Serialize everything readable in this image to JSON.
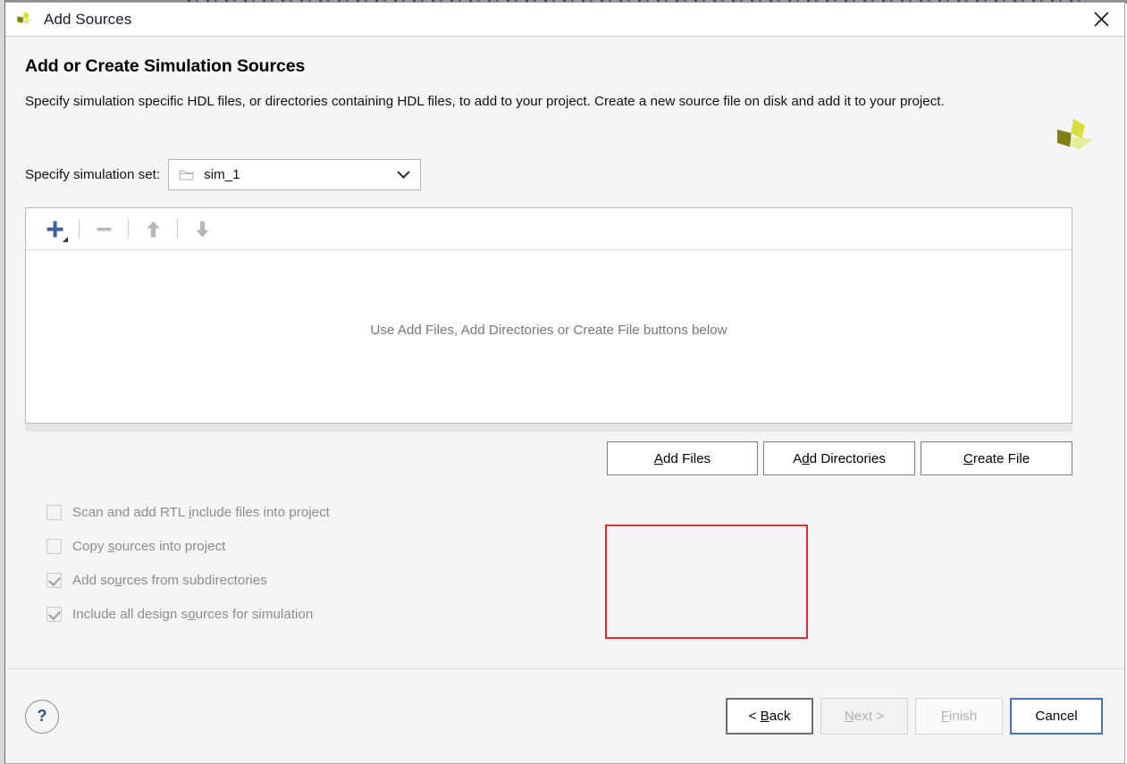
{
  "window": {
    "title": "Add Sources",
    "logo_icon": "xilinx-logo-icon",
    "close_icon": "close-icon"
  },
  "header": {
    "heading": "Add or Create Simulation Sources",
    "description": "Specify simulation specific HDL files, or directories containing HDL files, to add to your project. Create a new source file on disk and add it to your project.",
    "logo_icon": "xilinx-logo-icon"
  },
  "simulation_set": {
    "label": "Specify simulation set:",
    "value": "sim_1",
    "folder_icon": "folder-icon",
    "chevron_icon": "chevron-down-icon"
  },
  "file_panel": {
    "toolbar": {
      "add_icon": "plus-icon",
      "add_dropdown_icon": "dropdown-caret-icon",
      "remove_icon": "minus-icon",
      "move_up_icon": "arrow-up-icon",
      "move_down_icon": "arrow-down-icon"
    },
    "empty_message": "Use Add Files, Add Directories or Create File buttons below"
  },
  "action_buttons": [
    {
      "name": "add-files-button",
      "pre": "A",
      "mnemonic": "",
      "label_before": "A",
      "label_mnemonic": "A",
      "label_rest": "dd Files",
      "text": "Add Files"
    },
    {
      "name": "add-directories-button",
      "pre": "Ad",
      "mnemonic": "d",
      "label_rest": "d Directories",
      "text": "Add Directories"
    },
    {
      "name": "create-file-button",
      "pre": "",
      "mnemonic": "C",
      "label_rest": "reate File",
      "text": "Create File"
    }
  ],
  "action_labels": {
    "add_files_head": "",
    "add_files_mnemonic": "A",
    "add_files_tail": "dd Files",
    "add_dirs_head": "A",
    "add_dirs_mnemonic": "d",
    "add_dirs_tail": "d Directories",
    "create_file_head": "",
    "create_file_mnemonic": "C",
    "create_file_tail": "reate File"
  },
  "annotation": {
    "shape": "rectangle",
    "color": "#e8262d",
    "highlights": "create-file-button"
  },
  "checkboxes": [
    {
      "name": "scan-rtl-include-checkbox",
      "checked": false,
      "enabled": false,
      "head": "Scan and add RTL ",
      "mnemonic": "i",
      "tail": "nclude files into project",
      "text": "Scan and add RTL include files into project"
    },
    {
      "name": "copy-sources-checkbox",
      "checked": false,
      "enabled": false,
      "head": "Copy ",
      "mnemonic": "s",
      "tail": "ources into project",
      "text": "Copy sources into project"
    },
    {
      "name": "add-subdirectories-checkbox",
      "checked": true,
      "enabled": false,
      "head": "Add so",
      "mnemonic": "u",
      "tail": "rces from subdirectories",
      "text": "Add sources from subdirectories"
    },
    {
      "name": "include-design-sources-checkbox",
      "checked": true,
      "enabled": false,
      "head": "Include all design s",
      "mnemonic": "o",
      "tail": "urces for simulation",
      "text": "Include all design sources for simulation"
    }
  ],
  "footer": {
    "help_label": "?",
    "back": {
      "head": "< ",
      "mnemonic": "B",
      "tail": "ack",
      "text": "< Back",
      "enabled": true
    },
    "next": {
      "head": "",
      "mnemonic": "N",
      "tail": "ext >",
      "text": "Next >",
      "enabled": false
    },
    "finish": {
      "head": "",
      "mnemonic": "F",
      "tail": "inish",
      "text": "Finish",
      "enabled": false
    },
    "cancel": {
      "text": "Cancel",
      "enabled": true,
      "focused": true
    }
  },
  "colors": {
    "accent_blue": "#3f74c0",
    "annotation_red": "#e8262d",
    "plus_blue": "#3f5f9b",
    "logo_bright": "#d6e03a",
    "logo_dark": "#7f7f16",
    "logo_pale": "#e4ec9a",
    "background": "#f5f5f5"
  }
}
